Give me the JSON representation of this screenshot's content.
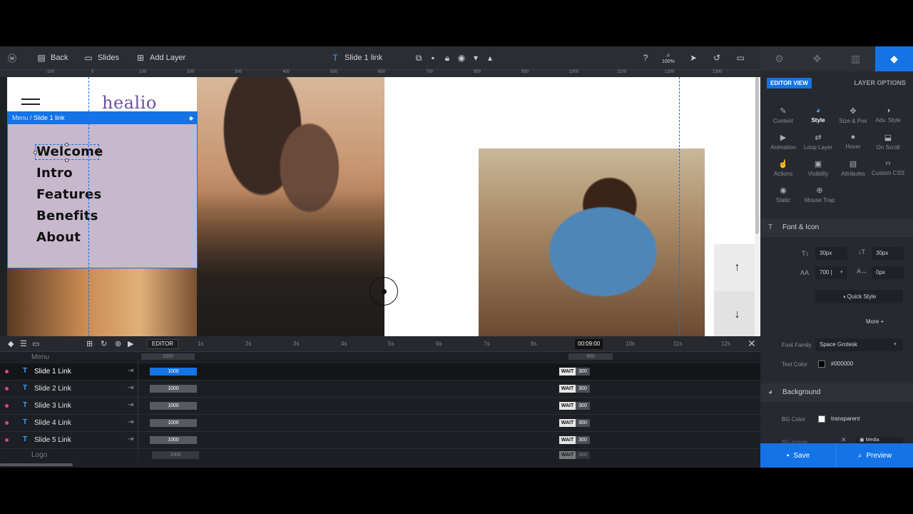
{
  "toolbar": {
    "back_label": "Back",
    "slides_label": "Slides",
    "add_layer_label": "Add Layer",
    "current_layer": "Slide 1 link",
    "zoom": "100%",
    "icons": [
      "wordpress-icon",
      "back-icon",
      "slides-icon",
      "add-layer-icon",
      "text-layer-icon",
      "duplicate-icon",
      "trash-icon",
      "lock-icon",
      "eye-icon",
      "chevron-down-icon",
      "chevron-up-icon",
      "help-icon",
      "zoom-icon",
      "cursor-icon",
      "undo-icon",
      "desktop-icon"
    ]
  },
  "ruler": {
    "ticks": [
      "-100",
      "0",
      "100",
      "200",
      "300",
      "400",
      "500",
      "600",
      "700",
      "800",
      "900",
      "1000",
      "1100",
      "1200",
      "1300"
    ]
  },
  "canvas": {
    "brand": "healio",
    "menu_breadcrumb_parent": "Menu",
    "menu_breadcrumb_sep": " / ",
    "menu_breadcrumb_current": "Slide 1 link",
    "menu_links": [
      "Welcome",
      "Intro",
      "Features",
      "Benefits",
      "About"
    ],
    "arrow_up": "↑",
    "arrow_down": "↓"
  },
  "timeline": {
    "editor_label": "EDITOR",
    "seconds": [
      "1s",
      "2s",
      "3s",
      "4s",
      "5s",
      "6s",
      "7s",
      "8s",
      "9s",
      "10s",
      "11s",
      "12s"
    ],
    "current_time": "00:09:00",
    "group_top": {
      "name": "Menu",
      "start_value": "1000",
      "end_value": "800"
    },
    "rows": [
      {
        "name": "Slide 1 Link",
        "duration": "1000",
        "wait_label": "WAIT",
        "wait_value": "300",
        "active": true
      },
      {
        "name": "Slide 2 Link",
        "duration": "1000",
        "wait_label": "WAIT",
        "wait_value": "300",
        "active": false
      },
      {
        "name": "Slide 3 Link",
        "duration": "1000",
        "wait_label": "WAIT",
        "wait_value": "300",
        "active": false
      },
      {
        "name": "Slide 4 Link",
        "duration": "1000",
        "wait_label": "WAIT",
        "wait_value": "300",
        "active": false
      },
      {
        "name": "Slide 5 Link",
        "duration": "1000",
        "wait_label": "WAIT",
        "wait_value": "300",
        "active": false
      }
    ],
    "group_bottom": {
      "name": "Logo",
      "duration": "1000",
      "wait_label": "WAIT",
      "wait_value": "300"
    }
  },
  "right_panel": {
    "tabs": [
      "settings-icon",
      "navigation-icon",
      "slides-panel-icon",
      "layers-icon"
    ],
    "editor_view_label": "EDITOR VIEW",
    "layer_options_label": "LAYER OPTIONS",
    "options": [
      {
        "label": "Content",
        "icon": "✎"
      },
      {
        "label": "Style",
        "icon": "◕"
      },
      {
        "label": "Size & Pos",
        "icon": "✥"
      },
      {
        "label": "Adv. Style",
        "icon": "◑"
      },
      {
        "label": "Animation",
        "icon": "▶"
      },
      {
        "label": "Loop Layer",
        "icon": "⇄"
      },
      {
        "label": "Hover",
        "icon": "●"
      },
      {
        "label": "On Scroll",
        "icon": "⬓"
      },
      {
        "label": "Actions",
        "icon": "☝"
      },
      {
        "label": "Visibility",
        "icon": "▣"
      },
      {
        "label": "Attributes",
        "icon": "▤"
      },
      {
        "label": "Custom CSS",
        "icon": "‹›"
      },
      {
        "label": "Static",
        "icon": "◉"
      },
      {
        "label": "Mouse Trap",
        "icon": "⊕"
      }
    ],
    "font_section": {
      "title": "Font & Icon",
      "font_size": "30px",
      "line_height": "30px",
      "font_weight": "700 |",
      "letter_spacing": "0px",
      "quick_style_label": "Quick Style",
      "more_label": "More",
      "font_family_label": "Font Family",
      "font_family_value": "Space Grotesk",
      "text_color_label": "Text Color",
      "text_color_value": "#000000"
    },
    "background_section": {
      "title": "Background",
      "bg_color_label": "BG Color",
      "bg_color_value": "transparent",
      "bg_image_label": "BG Image",
      "media_label": "Media"
    },
    "save_label": "Save",
    "preview_label": "Preview"
  },
  "colors": {
    "accent": "#1473e6",
    "menu_background": "#c7b8cc",
    "brand_text": "#6b4fa0",
    "keyframe_dot": "#e83e8c"
  }
}
